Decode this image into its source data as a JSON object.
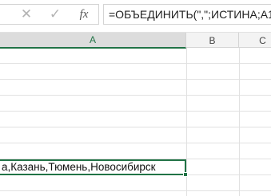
{
  "formula_bar": {
    "cancel_icon": "cancel-icon",
    "enter_icon": "enter-icon",
    "fx_label": "fx",
    "formula": "=ОБЪЕДИНИТЬ(\",\";ИСТИНА;A1:A"
  },
  "columns": [
    {
      "label": "A"
    },
    {
      "label": "B"
    },
    {
      "label": "C"
    }
  ],
  "active_cell": {
    "value": "а,Казань,Тюмень,Новосибирск"
  },
  "colors": {
    "accent": "#217346",
    "gridline": "#e1e1e1",
    "header_bg": "#f3f3f3"
  }
}
